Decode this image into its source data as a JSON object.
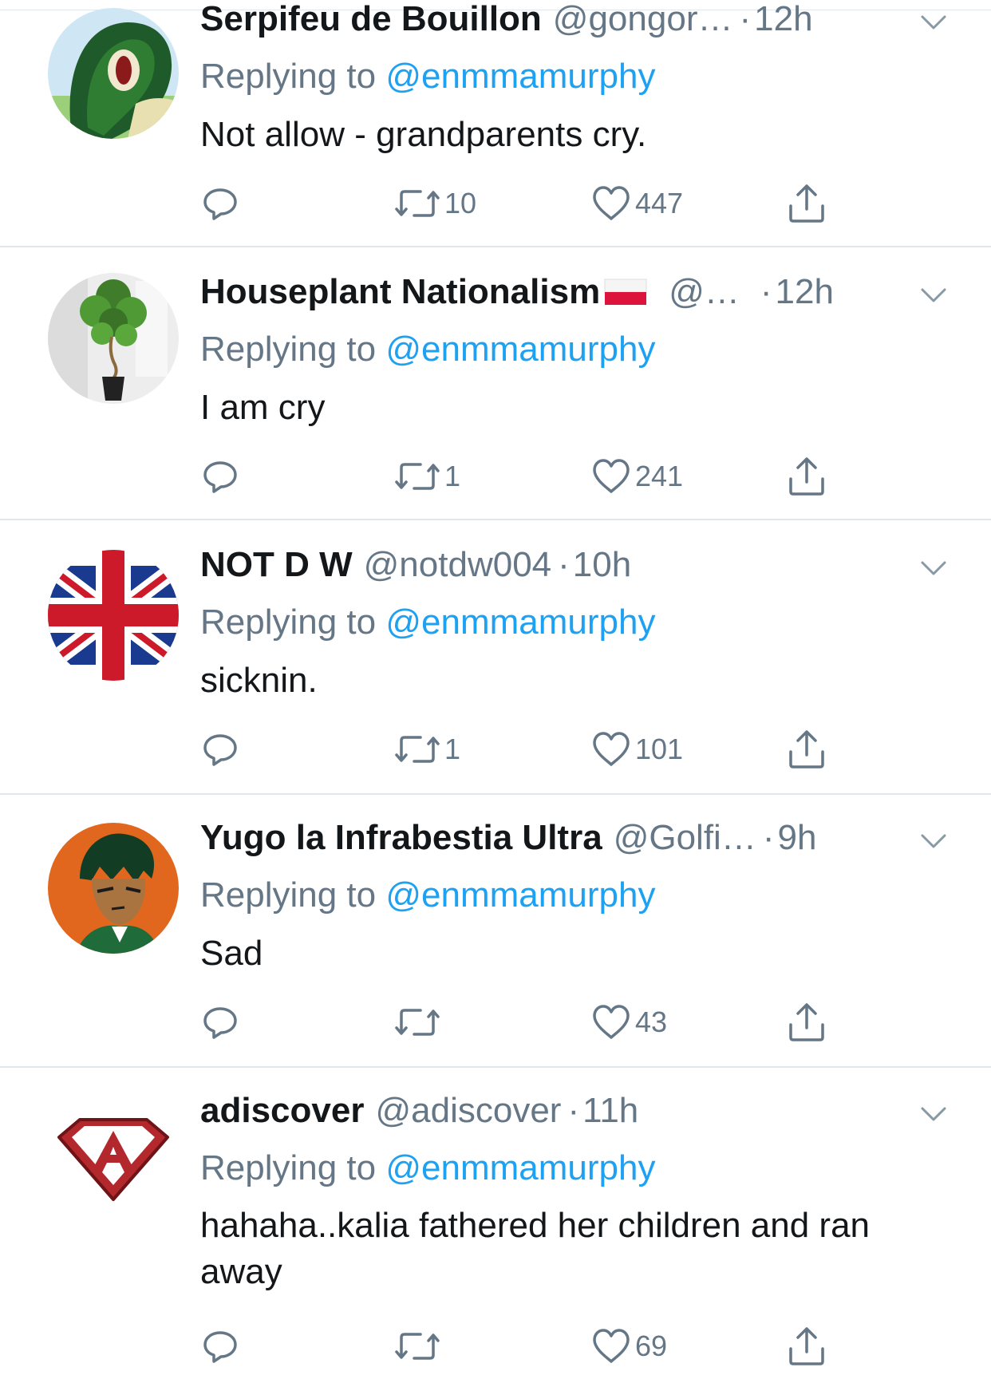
{
  "reply_prefix": "Replying to",
  "colors": {
    "link": "#1da1f2",
    "muted": "#657786",
    "text": "#14171a",
    "divider": "#e1e8ed"
  },
  "icons": [
    "reply-icon",
    "retweet-icon",
    "like-icon",
    "share-icon",
    "chevron-down-icon"
  ],
  "tweets": [
    {
      "name": "Serpifeu de Bouillon",
      "handle": "@gongor…",
      "time": "12h",
      "mention": "@enmmamurphy",
      "text": "Not allow - grandparents cry.",
      "retweets": "10",
      "likes": "447",
      "avatar": "green-snake-avatar"
    },
    {
      "name": "Houseplant Nationalism",
      "handle": "@…",
      "time": "12h",
      "mention": "@enmmamurphy",
      "text": "I am cry",
      "retweets": "1",
      "likes": "241",
      "avatar": "houseplant-avatar",
      "flag": "poland-flag"
    },
    {
      "name": "NOT D W",
      "handle": "@notdw004",
      "time": "10h",
      "mention": "@enmmamurphy",
      "text": "sicknin.",
      "retweets": "1",
      "likes": "101",
      "avatar": "union-jack-avatar"
    },
    {
      "name": "Yugo la Infrabestia Ultra",
      "handle": "@Golfi…",
      "time": "9h",
      "mention": "@enmmamurphy",
      "text": "Sad",
      "retweets": "",
      "likes": "43",
      "avatar": "anime-character-avatar"
    },
    {
      "name": "adiscover",
      "handle": "@adiscover",
      "time": "11h",
      "mention": "@enmmamurphy",
      "text": "hahaha..kalia fathered her children and ran away",
      "retweets": "",
      "likes": "69",
      "avatar": "superhero-a-logo-avatar"
    }
  ]
}
